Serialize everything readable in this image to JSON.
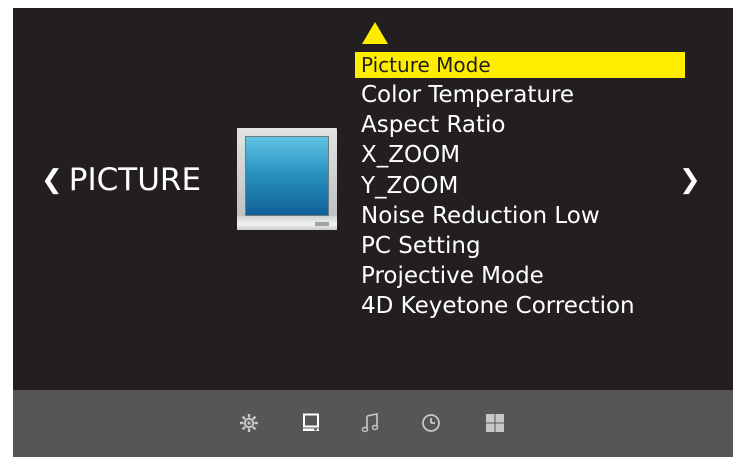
{
  "section": {
    "title": "PICTURE",
    "prev_icon": "chevron-left-icon",
    "next_icon": "chevron-right-icon"
  },
  "menu": {
    "items": [
      {
        "label": "Picture Mode",
        "selected": true
      },
      {
        "label": "Color Temperature",
        "selected": false
      },
      {
        "label": "Aspect Ratio",
        "selected": false
      },
      {
        "label": "X_ZOOM",
        "selected": false
      },
      {
        "label": "Y_ZOOM",
        "selected": false
      },
      {
        "label": "Noise Reduction Low",
        "selected": false
      },
      {
        "label": "PC Setting",
        "selected": false
      },
      {
        "label": "Projective Mode",
        "selected": false
      },
      {
        "label": "4D Keyetone Correction",
        "selected": false
      }
    ]
  },
  "bottom_icons": [
    {
      "name": "gear-icon",
      "active": false
    },
    {
      "name": "monitor-icon",
      "active": true
    },
    {
      "name": "music-note-icon",
      "active": false
    },
    {
      "name": "clock-icon",
      "active": false
    },
    {
      "name": "grid-icon",
      "active": false
    }
  ],
  "colors": {
    "background": "#231f20",
    "highlight": "#ffed00",
    "bottom_bar": "#575556",
    "icon_inactive": "#c8c7c8",
    "icon_active": "#ffffff"
  }
}
